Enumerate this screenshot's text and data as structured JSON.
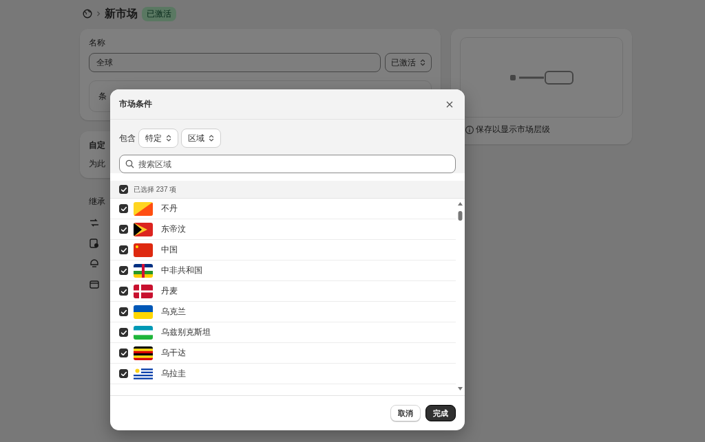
{
  "header": {
    "title": "新市场",
    "status": "已激活"
  },
  "name_card": {
    "label": "名称",
    "value": "全球",
    "status_select": "已激活",
    "conditions_label": "条"
  },
  "custom_card": {
    "title": "自定",
    "description": "为此"
  },
  "inherited": {
    "title": "继承",
    "items": [
      {
        "kind": "currency"
      },
      {
        "kind": "product"
      },
      {
        "kind": "store"
      },
      {
        "kind": "domain"
      }
    ]
  },
  "hierarchy_card": {
    "note": "保存以显示市场层级"
  },
  "modal": {
    "title": "市场条件",
    "include_label": "包含",
    "scope_select": "特定",
    "type_select": "区域",
    "search_placeholder": "搜索区域",
    "select_all": {
      "label": "已选择 237 项",
      "checked": true
    },
    "countries": [
      {
        "name": "不丹",
        "checked": true,
        "kind": "diagonal"
      },
      {
        "name": "东帝汶",
        "checked": true,
        "kind": "chevron"
      },
      {
        "name": "中国",
        "checked": true,
        "kind": "star"
      },
      {
        "name": "中非共和国",
        "checked": true,
        "kind": "crossed"
      },
      {
        "name": "丹麦",
        "checked": true,
        "kind": "nordic"
      },
      {
        "name": "乌克兰",
        "checked": true,
        "kind": "bicolor"
      },
      {
        "name": "乌兹别克斯坦",
        "checked": true,
        "kind": "tricolor"
      },
      {
        "name": "乌干达",
        "checked": true,
        "kind": "sixband"
      },
      {
        "name": "乌拉圭",
        "checked": true,
        "kind": "sunstripes"
      }
    ],
    "buttons": [
      {
        "label": "取消",
        "kind": "secondary"
      },
      {
        "label": "完成",
        "kind": "primary"
      }
    ]
  }
}
